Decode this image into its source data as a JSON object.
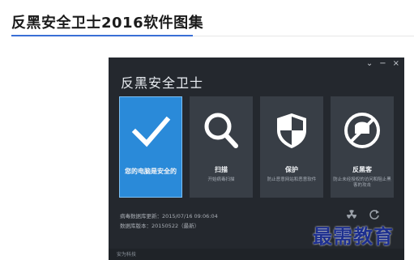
{
  "article": {
    "title": "反黑安全卫士2016软件图集"
  },
  "app": {
    "title": "反黑安全卫士",
    "window_controls": [
      "⌄",
      "−",
      "×"
    ],
    "tiles": [
      {
        "title": "您的电脑是安全的",
        "subtitle": "",
        "icon": "checkmark-icon"
      },
      {
        "title": "扫描",
        "subtitle": "开始病毒扫描",
        "icon": "search-icon"
      },
      {
        "title": "保护",
        "subtitle": "防止恶意网站和恶意软件",
        "icon": "shield-icon"
      },
      {
        "title": "反黑客",
        "subtitle": "防止未经授权的访问和阻止黑客的攻击",
        "icon": "no-hacker-icon"
      }
    ],
    "status": {
      "update_label": "病毒数据库更新：",
      "update_value": "2015/07/16 09:06:04",
      "version_label": "数据库版本：",
      "version_value": "20150522（最新）"
    },
    "footer_logo": "安为科技"
  },
  "watermark": "最需教育",
  "colors": {
    "accent": "#2a8ad9",
    "panel": "#24282e",
    "tile": "#383e46",
    "watermark": "#1d2f8f"
  }
}
